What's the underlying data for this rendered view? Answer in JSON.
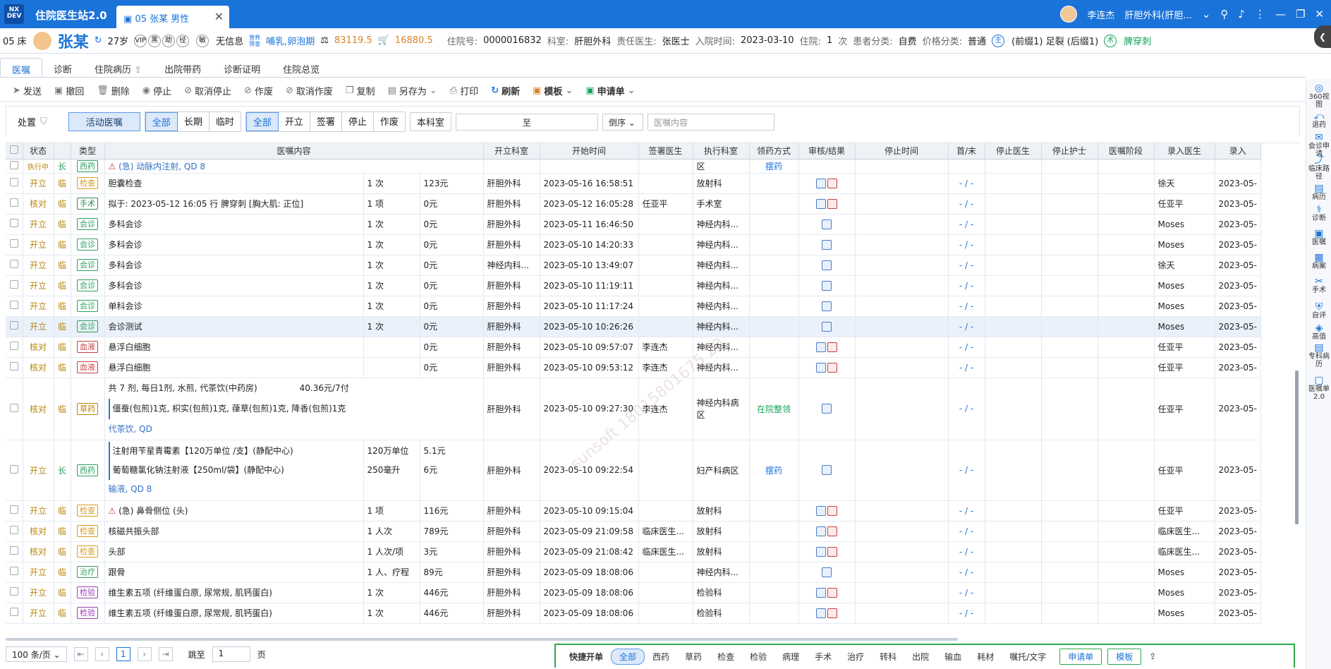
{
  "app": {
    "title": "住院医生站2.0",
    "logo_top": "NX",
    "logo_bottom": "DEV",
    "tab": "05 张某 男性",
    "user": "李连杰",
    "dept": "肝胆外科(肝胆..."
  },
  "patient": {
    "bed": "05 床",
    "name": "张某",
    "age": "27岁",
    "chips": [
      "VIP",
      "黑",
      "助",
      "径",
      "敏"
    ],
    "info_label": "无信息",
    "nutrition_label": "营养\n筛查",
    "diet": "哺乳,卵泡期",
    "balance1": "83119.5",
    "balance2": "16880.5",
    "admission_no_label": "住院号:",
    "admission_no": "0000016832",
    "dept_label": "科室:",
    "dept": "肝胆外科",
    "doctor_label": "责任医生:",
    "doctor": "张医士",
    "date_label": "入院时间:",
    "date": "2023-03-10",
    "times_label": "住院:",
    "times": "1",
    "times_unit": "次",
    "class_label": "患者分类:",
    "class": "自费",
    "price_label": "价格分类:",
    "price": "普通",
    "tag_main": "(前缀1) 足裂 (后缀1)",
    "tag_op": "脾穿刺"
  },
  "nav": {
    "tabs": [
      "医嘱",
      "诊断",
      "住院病历",
      "出院带药",
      "诊断证明",
      "住院总览"
    ]
  },
  "toolbar": {
    "items": [
      "发送",
      "撤回",
      "删除",
      "停止",
      "取消停止",
      "作废",
      "取消作废",
      "复制",
      "另存为",
      "打印",
      "刷新",
      "模板",
      "申请单"
    ]
  },
  "filters": {
    "title": "处置",
    "active": "活动医嘱",
    "group1": [
      "全部",
      "长期",
      "临时"
    ],
    "group2": [
      "全部",
      "开立",
      "签署",
      "停止",
      "作废"
    ],
    "dept_btn": "本科室",
    "range_sep": "至",
    "order": "倒序",
    "search_placeholder": "医嘱内容"
  },
  "table": {
    "headers": [
      "状态",
      "",
      "类型",
      "医嘱内容",
      "",
      "",
      "开立科室",
      "开始时间",
      "签署医生",
      "执行科室",
      "领药方式",
      "审核/结果",
      "停止时间",
      "首/末",
      "停止医生",
      "停止护士",
      "医嘱阶段",
      "录入医生",
      "录入"
    ],
    "header_main": {
      "status": "状态",
      "type": "类型",
      "content": "医嘱内容",
      "dept": "开立科室",
      "start": "开始时间",
      "sign": "签署医生",
      "exec": "执行科室",
      "drug": "领药方式",
      "audit": "审核/结果",
      "stop": "停止时间",
      "first": "首/末",
      "stopdoc": "停止医生",
      "stopnurse": "停止护士",
      "stage": "医嘱阶段",
      "entry": "录入医生",
      "entry2": "录入"
    },
    "partial": {
      "content": "(急) 动脉内注射, QD 8",
      "status": "执行中",
      "type": "长",
      "tag": "西药",
      "exec": "区",
      "drug": "摆药"
    },
    "rows": [
      {
        "status": "开立",
        "kind": "临",
        "tag": "检查",
        "content": "胆囊检查",
        "qty": "1 次",
        "price": "123元",
        "dept": "肝胆外科",
        "start": "2023-05-16 16:58:51",
        "sign": "",
        "exec": "放射科",
        "drug": "",
        "first": "- / -",
        "entry": "徐天",
        "entry2": "2023-05-"
      },
      {
        "status": "核对",
        "kind": "临",
        "tag": "手术",
        "content": "拟于: 2023-05-12 16:05 行 脾穿刺 [胸大肌: 正位]",
        "qty": "1 项",
        "price": "0元",
        "dept": "肝胆外科",
        "start": "2023-05-12 16:05:28",
        "sign": "任亚平",
        "exec": "手术室",
        "drug": "",
        "first": "- / -",
        "entry": "任亚平",
        "entry2": "2023-05-"
      },
      {
        "status": "开立",
        "kind": "临",
        "tag": "会诊",
        "content": "多科会诊",
        "qty": "1 次",
        "price": "0元",
        "dept": "肝胆外科",
        "start": "2023-05-11 16:46:50",
        "sign": "",
        "exec": "神经内科...",
        "drug": "",
        "first": "- / -",
        "entry": "Moses",
        "entry2": "2023-05-"
      },
      {
        "status": "开立",
        "kind": "临",
        "tag": "会诊",
        "content": "多科会诊",
        "qty": "1 次",
        "price": "0元",
        "dept": "肝胆外科",
        "start": "2023-05-10 14:20:33",
        "sign": "",
        "exec": "神经内科...",
        "drug": "",
        "first": "- / -",
        "entry": "Moses",
        "entry2": "2023-05-"
      },
      {
        "status": "开立",
        "kind": "临",
        "tag": "会诊",
        "content": "多科会诊",
        "qty": "1 次",
        "price": "0元",
        "dept": "神经内科...",
        "start": "2023-05-10 13:49:07",
        "sign": "",
        "exec": "神经内科...",
        "drug": "",
        "first": "- / -",
        "entry": "徐天",
        "entry2": "2023-05-"
      },
      {
        "status": "开立",
        "kind": "临",
        "tag": "会诊",
        "content": "多科会诊",
        "qty": "1 次",
        "price": "0元",
        "dept": "肝胆外科",
        "start": "2023-05-10 11:19:11",
        "sign": "",
        "exec": "神经内科...",
        "drug": "",
        "first": "- / -",
        "entry": "Moses",
        "entry2": "2023-05-"
      },
      {
        "status": "开立",
        "kind": "临",
        "tag": "会诊",
        "content": "单科会诊",
        "qty": "1 次",
        "price": "0元",
        "dept": "肝胆外科",
        "start": "2023-05-10 11:17:24",
        "sign": "",
        "exec": "神经内科...",
        "drug": "",
        "first": "- / -",
        "entry": "Moses",
        "entry2": "2023-05-"
      },
      {
        "status": "开立",
        "kind": "临",
        "tag": "会诊",
        "content": "会诊测试",
        "qty": "1 次",
        "price": "0元",
        "dept": "肝胆外科",
        "start": "2023-05-10 10:26:26",
        "sign": "",
        "exec": "神经内科...",
        "drug": "",
        "first": "- / -",
        "entry": "Moses",
        "entry2": "2023-05-"
      },
      {
        "status": "核对",
        "kind": "临",
        "tag": "血液",
        "content": "悬浮白细胞",
        "qty": "",
        "price": "0元",
        "dept": "肝胆外科",
        "start": "2023-05-10 09:57:07",
        "sign": "李连杰",
        "exec": "神经内科...",
        "drug": "",
        "first": "- / -",
        "entry": "任亚平",
        "entry2": "2023-05-"
      },
      {
        "status": "核对",
        "kind": "临",
        "tag": "血液",
        "content": "悬浮白细胞",
        "qty": "",
        "price": "0元",
        "dept": "肝胆外科",
        "start": "2023-05-10 09:53:12",
        "sign": "李连杰",
        "exec": "神经内科...",
        "drug": "",
        "first": "- / -",
        "entry": "任亚平",
        "entry2": "2023-05-"
      }
    ],
    "herb": {
      "status": "核对",
      "kind": "临",
      "tag": "草药",
      "line1": "共 7 剂, 每日1剂, 水煎, 代茶饮(中药房)",
      "line1_qty": "40.36元/7付",
      "line2": "僵蚕(包煎)1克, 枳实(包煎)1克, 葎草(包煎)1克, 降香(包煎)1克",
      "line3": "代茶饮, QD",
      "dept": "肝胆外科",
      "start": "2023-05-10 09:27:30",
      "sign": "李连杰",
      "exec": "神经内科病区",
      "drug": "在院整领",
      "first": "- / -",
      "entry": "任亚平",
      "entry2": "2023-05-"
    },
    "combo": {
      "status": "开立",
      "kind": "长",
      "tag": "西药",
      "line1": "注射用苄星青霉素【120万单位 /支】(静配中心)",
      "line1_qty": "120万单位",
      "line1_price": "5.1元",
      "line2": "葡萄糖氯化钠注射液【250ml/袋】(静配中心)",
      "line2_qty": "250毫升",
      "line2_price": "6元",
      "line3": "输液, QD 8",
      "dept": "肝胆外科",
      "start": "2023-05-10 09:22:54",
      "exec": "妇产科病区",
      "drug": "摆药",
      "first": "- / -",
      "entry": "任亚平",
      "entry2": "2023-05-"
    },
    "rows2": [
      {
        "status": "开立",
        "kind": "临",
        "tag": "检查",
        "content": "(急) 鼻骨侧位 (头)",
        "qty": "1 项",
        "price": "116元",
        "dept": "肝胆外科",
        "start": "2023-05-10 09:15:04",
        "sign": "",
        "exec": "放射科",
        "first": "- / -",
        "entry": "任亚平",
        "entry2": "2023-05-"
      },
      {
        "status": "核对",
        "kind": "临",
        "tag": "检查",
        "content": "核磁共振头部",
        "qty": "1 人次",
        "price": "789元",
        "dept": "肝胆外科",
        "start": "2023-05-09 21:09:58",
        "sign": "临床医生...",
        "exec": "放射科",
        "first": "- / -",
        "entry": "临床医生...",
        "entry2": "2023-05-"
      },
      {
        "status": "核对",
        "kind": "临",
        "tag": "检查",
        "content": "头部",
        "qty": "1 人次/项",
        "price": "3元",
        "dept": "肝胆外科",
        "start": "2023-05-09 21:08:42",
        "sign": "临床医生...",
        "exec": "放射科",
        "first": "- / -",
        "entry": "临床医生...",
        "entry2": "2023-05-"
      },
      {
        "status": "开立",
        "kind": "临",
        "tag": "治疗",
        "content": "跟骨",
        "qty": "1 人、疗程",
        "price": "89元",
        "dept": "肝胆外科",
        "start": "2023-05-09 18:08:06",
        "sign": "",
        "exec": "神经内科...",
        "first": "- / -",
        "entry": "Moses",
        "entry2": "2023-05-"
      },
      {
        "status": "开立",
        "kind": "临",
        "tag": "检验",
        "content": "维生素五项 (纤维蛋白原, 尿常规, 肌钙蛋白)",
        "qty": "1 次",
        "price": "446元",
        "dept": "肝胆外科",
        "start": "2023-05-09 18:08:06",
        "sign": "",
        "exec": "检验科",
        "first": "- / -",
        "entry": "Moses",
        "entry2": "2023-05-"
      },
      {
        "status": "开立",
        "kind": "临",
        "tag": "检验",
        "content": "维生素五项 (纤维蛋白原, 尿常规, 肌钙蛋白)",
        "qty": "1 次",
        "price": "446元",
        "dept": "肝胆外科",
        "start": "2023-05-09 18:08:06",
        "sign": "",
        "exec": "检验科",
        "first": "- / -",
        "entry": "Moses",
        "entry2": "2023-05-"
      }
    ]
  },
  "tag_colors": {
    "检查": "#d99a1f",
    "手术": "#2e8b57",
    "会诊": "#2e9f5f",
    "血液": "#c43f3f",
    "草药": "#b8860b",
    "西药": "#2e9f5f",
    "治疗": "#2e9f5f",
    "检验": "#9b3fb5"
  },
  "pager": {
    "per_page": "100 条/页",
    "page": "1",
    "jump_label": "跳至",
    "jump_value": "1",
    "page_unit": "页"
  },
  "bottom": {
    "title": "快捷开单",
    "items": [
      "全部",
      "西药",
      "草药",
      "检查",
      "检验",
      "病理",
      "手术",
      "治疗",
      "转科",
      "出院",
      "输血",
      "耗材",
      "嘱托/文字"
    ],
    "apply": "申请单",
    "tpl": "模板"
  },
  "rightbar": [
    "360视图",
    "退药",
    "会诊申请",
    "临床路径",
    "病历",
    "诊断",
    "医嘱",
    "病案",
    "手术",
    "自评",
    "高值",
    "专科病历",
    "医嘱单2.0"
  ],
  "watermark": "sunsoft 18015801675 20"
}
